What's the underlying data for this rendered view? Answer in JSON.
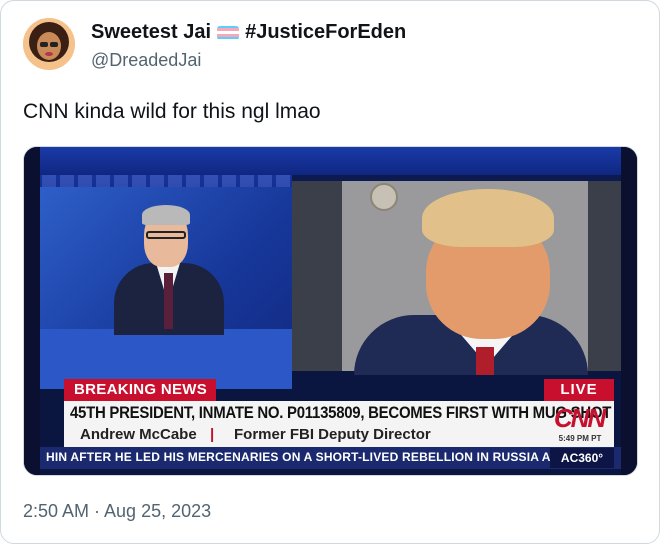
{
  "tweet": {
    "display_name": "Sweetest Jai",
    "hashtag": "#JusticeForEden",
    "handle": "@DreadedJai",
    "text": "CNN kinda wild for this ngl lmao",
    "timestamp": "2:50 AM · Aug 25, 2023",
    "flag_colors": [
      "#5bcefa",
      "#f5a9b8",
      "#ffffff",
      "#f5a9b8",
      "#5bcefa"
    ]
  },
  "media": {
    "breaking_label": "BREAKING NEWS",
    "live_label": "LIVE",
    "headline": "45TH PRESIDENT, INMATE NO. P01135809, BECOMES FIRST WITH MUG SHOT",
    "guest_name": "Andrew McCabe",
    "separator": "|",
    "guest_title": "Former FBI Deputy Director",
    "network": "CNN",
    "time": "5:49 PM PT",
    "ticker": "HIN AFTER HE LED HIS MERCENARIES ON A SHORT-LIVED REBELLION IN RUSSIA A",
    "show": "AC360°"
  }
}
